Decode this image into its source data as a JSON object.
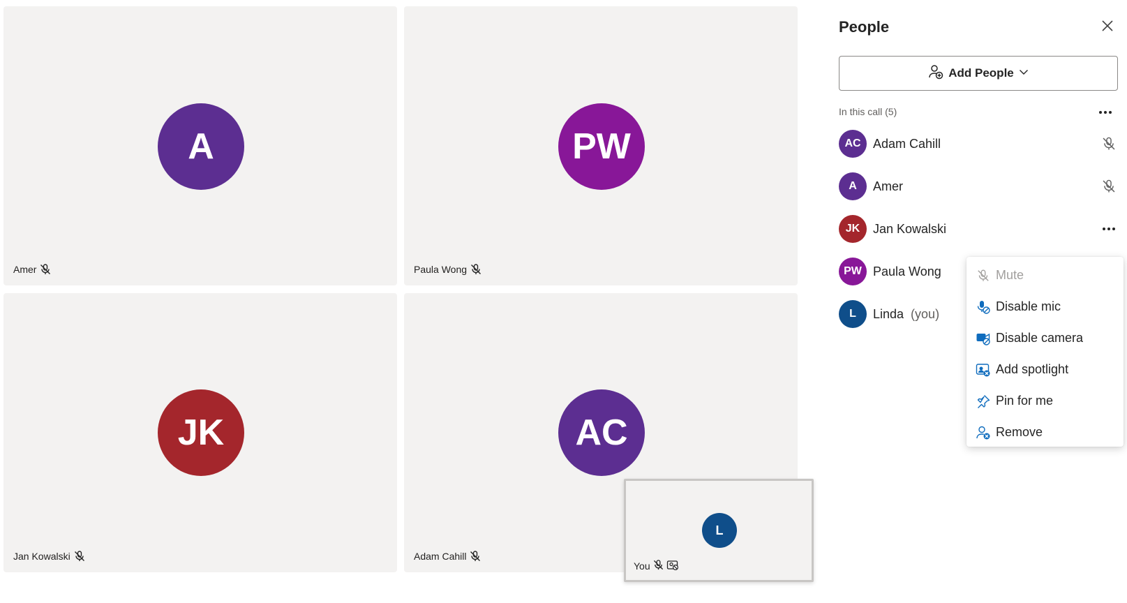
{
  "tiles": [
    {
      "initials": "A",
      "name": "Amer",
      "color": "#5c2e91"
    },
    {
      "initials": "PW",
      "name": "Paula Wong",
      "color": "#881798"
    },
    {
      "initials": "JK",
      "name": "Jan Kowalski",
      "color": "#a4262c"
    },
    {
      "initials": "AC",
      "name": "Adam Cahill",
      "color": "#5c2e91"
    }
  ],
  "self_view": {
    "initials": "L",
    "label": "You",
    "color": "#0f4e8a"
  },
  "panel": {
    "title": "People",
    "add_people_label": "Add People",
    "section_label": "In this call (5)",
    "people": [
      {
        "initials": "AC",
        "name": "Adam Cahill",
        "color": "#5c2e91",
        "suffix": "",
        "icon": "mic-off-icon"
      },
      {
        "initials": "A",
        "name": "Amer",
        "color": "#5c2e91",
        "suffix": "",
        "icon": "mic-off-icon"
      },
      {
        "initials": "JK",
        "name": "Jan Kowalski",
        "color": "#a4262c",
        "suffix": "",
        "icon": "more-icon"
      },
      {
        "initials": "PW",
        "name": "Paula Wong",
        "color": "#881798",
        "suffix": "",
        "icon": ""
      },
      {
        "initials": "L",
        "name": "Linda",
        "color": "#0f4e8a",
        "suffix": "(you)",
        "icon": ""
      }
    ]
  },
  "menu": {
    "items": [
      {
        "label": "Mute",
        "icon": "mic-off-icon",
        "disabled": true
      },
      {
        "label": "Disable mic",
        "icon": "disable-mic-icon",
        "disabled": false
      },
      {
        "label": "Disable camera",
        "icon": "disable-camera-icon",
        "disabled": false
      },
      {
        "label": "Add spotlight",
        "icon": "spotlight-icon",
        "disabled": false
      },
      {
        "label": "Pin for me",
        "icon": "pin-icon",
        "disabled": false
      },
      {
        "label": "Remove",
        "icon": "remove-person-icon",
        "disabled": false
      }
    ]
  },
  "colors": {
    "accent": "#0f6cbd",
    "tile_bg": "#f3f2f1"
  }
}
